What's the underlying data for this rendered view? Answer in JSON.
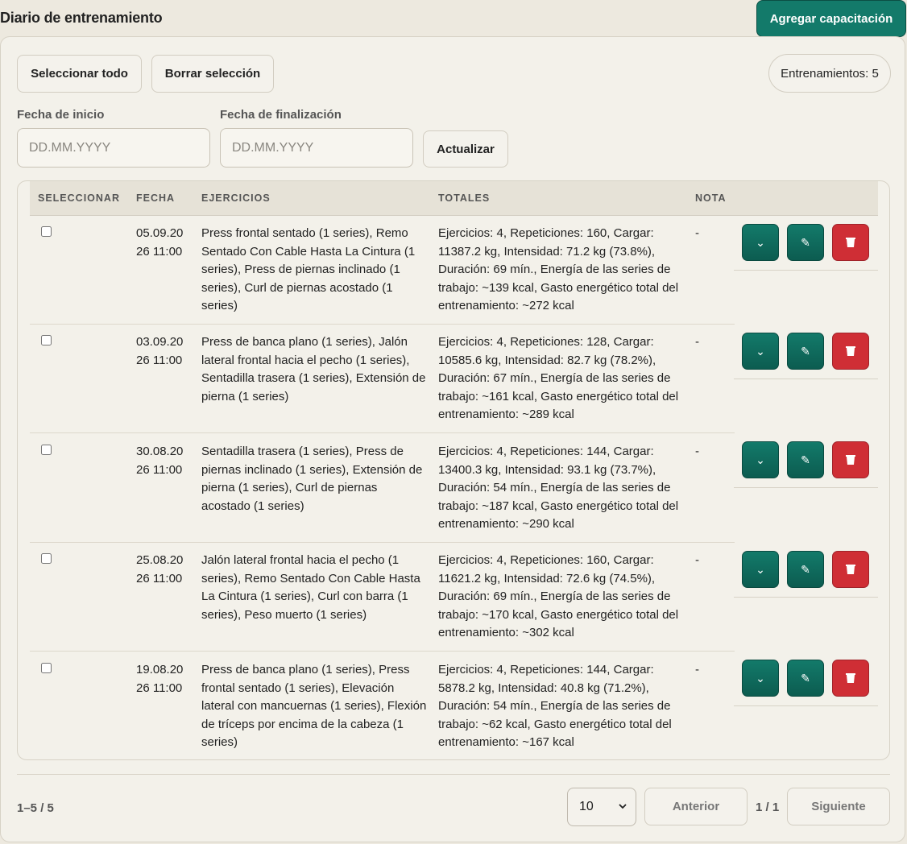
{
  "header": {
    "title": "Diario de entrenamiento",
    "add_label": "Agregar capacitación"
  },
  "toolbar": {
    "select_all": "Seleccionar todo",
    "clear_selection": "Borrar selección",
    "count": "Entrenamientos: 5"
  },
  "filters": {
    "start_label": "Fecha de inicio",
    "end_label": "Fecha de finalización",
    "placeholder": "DD.MM.YYYY",
    "update_label": "Actualizar"
  },
  "table": {
    "columns": [
      "SELECCIONAR",
      "FECHA",
      "EJERCICIOS",
      "TOTALES",
      "NOTA"
    ],
    "rows": [
      {
        "date_line1": "05.09.20",
        "date_line2": "26 11:00",
        "exercises": "Press frontal sentado (1 series), Remo Sentado Con Cable Hasta La Cintura (1 series), Press de piernas inclinado (1 series), Curl de piernas acostado (1 series)",
        "totals": "Ejercicios: 4, Repeticiones: 160, Cargar: 11387.2 kg, Intensidad: 71.2 kg (73.8%), Duración: 69 mín., Energía de las series de trabajo: ~139 kcal, Gasto energético total del entrenamiento: ~272 kcal",
        "note": "-"
      },
      {
        "date_line1": "03.09.20",
        "date_line2": "26 11:00",
        "exercises": "Press de banca plano (1 series), Jalón lateral frontal hacia el pecho (1 series), Sentadilla trasera (1 series), Extensión de pierna (1 series)",
        "totals": "Ejercicios: 4, Repeticiones: 128, Cargar: 10585.6 kg, Intensidad: 82.7 kg (78.2%), Duración: 67 mín., Energía de las series de trabajo: ~161 kcal, Gasto energético total del entrenamiento: ~289 kcal",
        "note": "-"
      },
      {
        "date_line1": "30.08.20",
        "date_line2": "26 11:00",
        "exercises": "Sentadilla trasera (1 series), Press de piernas inclinado (1 series), Extensión de pierna (1 series), Curl de piernas acostado (1 series)",
        "totals": "Ejercicios: 4, Repeticiones: 144, Cargar: 13400.3 kg, Intensidad: 93.1 kg (73.7%), Duración: 54 mín., Energía de las series de trabajo: ~187 kcal, Gasto energético total del entrenamiento: ~290 kcal",
        "note": "-"
      },
      {
        "date_line1": "25.08.20",
        "date_line2": "26 11:00",
        "exercises": "Jalón lateral frontal hacia el pecho (1 series), Remo Sentado Con Cable Hasta La Cintura (1 series), Curl con barra (1 series), Peso muerto (1 series)",
        "totals": "Ejercicios: 4, Repeticiones: 160, Cargar: 11621.2 kg, Intensidad: 72.6 kg (74.5%), Duración: 69 mín., Energía de las series de trabajo: ~170 kcal, Gasto energético total del entrenamiento: ~302 kcal",
        "note": "-"
      },
      {
        "date_line1": "19.08.20",
        "date_line2": "26 11:00",
        "exercises": "Press de banca plano (1 series), Press frontal sentado (1 series), Elevación lateral con mancuernas (1 series), Flexión de tríceps por encima de la cabeza (1 series)",
        "totals": "Ejercicios: 4, Repeticiones: 144, Cargar: 5878.2 kg, Intensidad: 40.8 kg (71.2%), Duración: 54 mín., Energía de las series de trabajo: ~62 kcal, Gasto energético total del entrenamiento: ~167 kcal",
        "note": "-"
      }
    ]
  },
  "icons": {
    "expand": "chevron-down-icon",
    "edit": "pencil-icon",
    "delete": "trash-icon"
  },
  "colors": {
    "primary": "#137a6a",
    "danger": "#cf2e35",
    "background": "#ede9df"
  },
  "pagination": {
    "range": "1–5 / 5",
    "page_size": "10",
    "prev_label": "Anterior",
    "page_label": "1 / 1",
    "next_label": "Siguiente"
  }
}
